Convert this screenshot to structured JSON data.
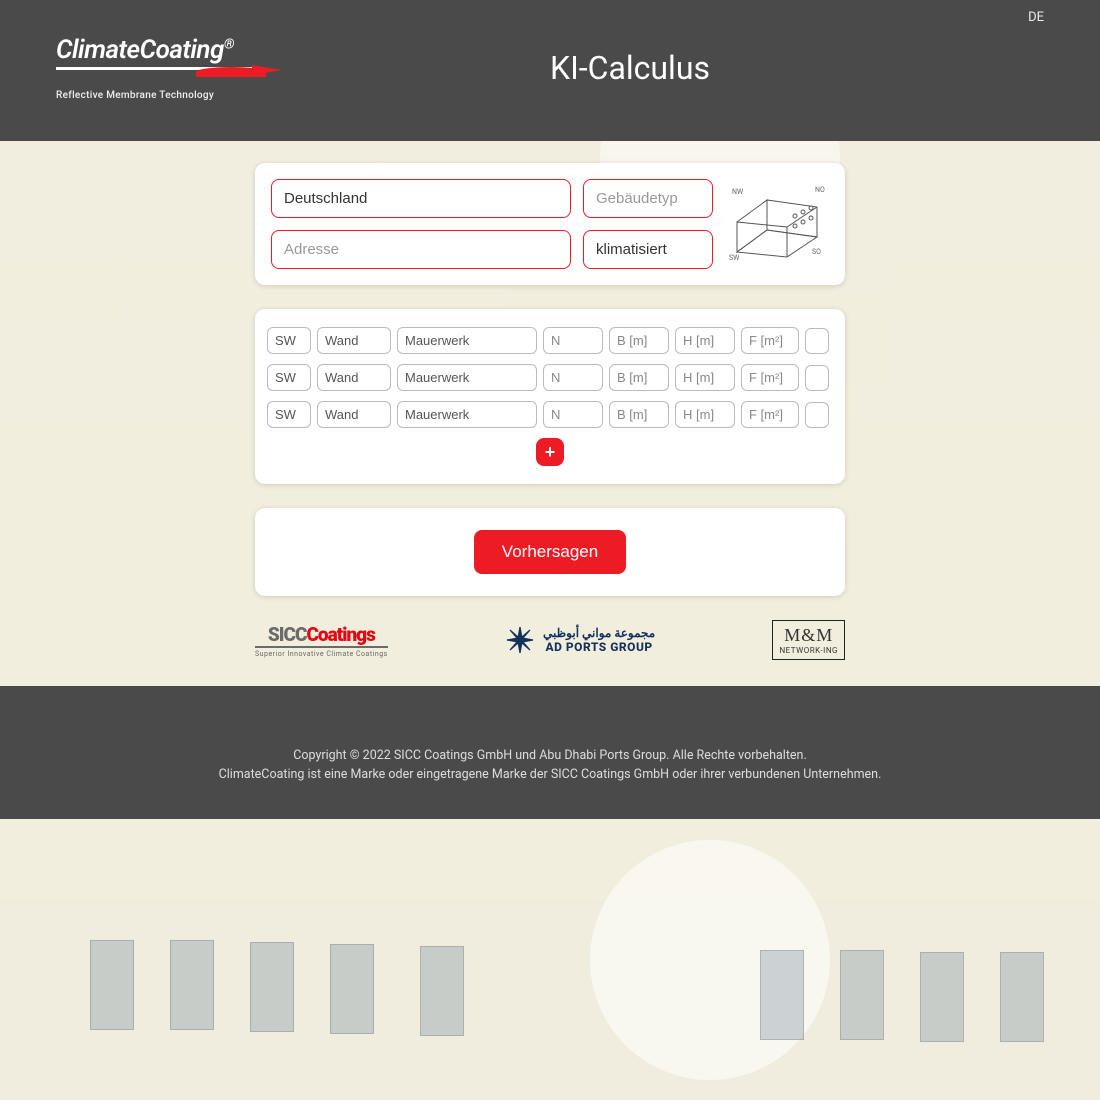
{
  "lang_label": "DE",
  "logo": {
    "main": "ClimateCoating",
    "reg": "®",
    "sub": "Reflective Membrane Technology"
  },
  "title": "KI-Calculus",
  "inputs": {
    "country_value": "Deutschland",
    "address_placeholder": "Adresse",
    "building_type_placeholder": "Gebäudetyp",
    "climate_value": "klimatisiert"
  },
  "row_defaults": {
    "sw": "SW",
    "wand": "Wand",
    "mauerwerk": "Mauerwerk",
    "n": "N",
    "b": "B [m]",
    "h": "H [m]",
    "f": "F [m²]"
  },
  "row_count": 3,
  "plus_label": "+",
  "predict_label": "Vorhersagen",
  "partners": {
    "sicc_main1": "SICC",
    "sicc_main2": "Coatings",
    "sicc_sub": "Superior Innovative Climate Coatings",
    "adports_ar": "مجموعة مواني أبوظبي",
    "adports_en": "AD PORTS GROUP",
    "mm_top": "M&M",
    "mm_bot": "NETWORK-ING"
  },
  "footer": {
    "line1": "Copyright © 2022 SICC Coatings GmbH und Abu Dhabi Ports Group. Alle Rechte vorbehalten.",
    "line2": "ClimateCoating ist eine Marke oder eingetragene Marke der SICC Coatings GmbH oder ihrer verbundenen Unternehmen."
  },
  "sketch_labels": {
    "nw": "NW",
    "no": "NO",
    "sw": "SW",
    "so": "SO"
  }
}
